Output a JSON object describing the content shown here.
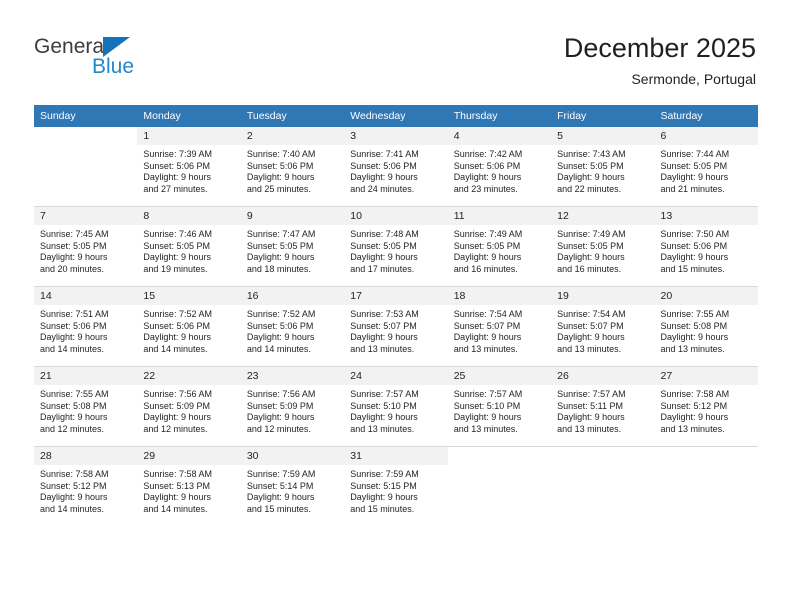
{
  "brand": {
    "name_top": "General",
    "name_bottom": "Blue",
    "triangle_color": "#1573b9",
    "blue_color": "#2288cc"
  },
  "header": {
    "title": "December 2025",
    "subtitle": "Sermonde, Portugal"
  },
  "theme": {
    "header_bar": "#2f77b5",
    "daynum_band": "#f2f2f2",
    "grid_line": "#d9d9d9",
    "text": "#231f20"
  },
  "weekday_headers": [
    "Sunday",
    "Monday",
    "Tuesday",
    "Wednesday",
    "Thursday",
    "Friday",
    "Saturday"
  ],
  "weeks": [
    [
      {
        "day": "",
        "blank": true,
        "sunrise": "",
        "sunset": "",
        "daylight1": "",
        "daylight2": ""
      },
      {
        "day": "1",
        "sunrise": "Sunrise: 7:39 AM",
        "sunset": "Sunset: 5:06 PM",
        "daylight1": "Daylight: 9 hours",
        "daylight2": "and 27 minutes."
      },
      {
        "day": "2",
        "sunrise": "Sunrise: 7:40 AM",
        "sunset": "Sunset: 5:06 PM",
        "daylight1": "Daylight: 9 hours",
        "daylight2": "and 25 minutes."
      },
      {
        "day": "3",
        "sunrise": "Sunrise: 7:41 AM",
        "sunset": "Sunset: 5:06 PM",
        "daylight1": "Daylight: 9 hours",
        "daylight2": "and 24 minutes."
      },
      {
        "day": "4",
        "sunrise": "Sunrise: 7:42 AM",
        "sunset": "Sunset: 5:06 PM",
        "daylight1": "Daylight: 9 hours",
        "daylight2": "and 23 minutes."
      },
      {
        "day": "5",
        "sunrise": "Sunrise: 7:43 AM",
        "sunset": "Sunset: 5:05 PM",
        "daylight1": "Daylight: 9 hours",
        "daylight2": "and 22 minutes."
      },
      {
        "day": "6",
        "sunrise": "Sunrise: 7:44 AM",
        "sunset": "Sunset: 5:05 PM",
        "daylight1": "Daylight: 9 hours",
        "daylight2": "and 21 minutes."
      }
    ],
    [
      {
        "day": "7",
        "sunrise": "Sunrise: 7:45 AM",
        "sunset": "Sunset: 5:05 PM",
        "daylight1": "Daylight: 9 hours",
        "daylight2": "and 20 minutes."
      },
      {
        "day": "8",
        "sunrise": "Sunrise: 7:46 AM",
        "sunset": "Sunset: 5:05 PM",
        "daylight1": "Daylight: 9 hours",
        "daylight2": "and 19 minutes."
      },
      {
        "day": "9",
        "sunrise": "Sunrise: 7:47 AM",
        "sunset": "Sunset: 5:05 PM",
        "daylight1": "Daylight: 9 hours",
        "daylight2": "and 18 minutes."
      },
      {
        "day": "10",
        "sunrise": "Sunrise: 7:48 AM",
        "sunset": "Sunset: 5:05 PM",
        "daylight1": "Daylight: 9 hours",
        "daylight2": "and 17 minutes."
      },
      {
        "day": "11",
        "sunrise": "Sunrise: 7:49 AM",
        "sunset": "Sunset: 5:05 PM",
        "daylight1": "Daylight: 9 hours",
        "daylight2": "and 16 minutes."
      },
      {
        "day": "12",
        "sunrise": "Sunrise: 7:49 AM",
        "sunset": "Sunset: 5:05 PM",
        "daylight1": "Daylight: 9 hours",
        "daylight2": "and 16 minutes."
      },
      {
        "day": "13",
        "sunrise": "Sunrise: 7:50 AM",
        "sunset": "Sunset: 5:06 PM",
        "daylight1": "Daylight: 9 hours",
        "daylight2": "and 15 minutes."
      }
    ],
    [
      {
        "day": "14",
        "sunrise": "Sunrise: 7:51 AM",
        "sunset": "Sunset: 5:06 PM",
        "daylight1": "Daylight: 9 hours",
        "daylight2": "and 14 minutes."
      },
      {
        "day": "15",
        "sunrise": "Sunrise: 7:52 AM",
        "sunset": "Sunset: 5:06 PM",
        "daylight1": "Daylight: 9 hours",
        "daylight2": "and 14 minutes."
      },
      {
        "day": "16",
        "sunrise": "Sunrise: 7:52 AM",
        "sunset": "Sunset: 5:06 PM",
        "daylight1": "Daylight: 9 hours",
        "daylight2": "and 14 minutes."
      },
      {
        "day": "17",
        "sunrise": "Sunrise: 7:53 AM",
        "sunset": "Sunset: 5:07 PM",
        "daylight1": "Daylight: 9 hours",
        "daylight2": "and 13 minutes."
      },
      {
        "day": "18",
        "sunrise": "Sunrise: 7:54 AM",
        "sunset": "Sunset: 5:07 PM",
        "daylight1": "Daylight: 9 hours",
        "daylight2": "and 13 minutes."
      },
      {
        "day": "19",
        "sunrise": "Sunrise: 7:54 AM",
        "sunset": "Sunset: 5:07 PM",
        "daylight1": "Daylight: 9 hours",
        "daylight2": "and 13 minutes."
      },
      {
        "day": "20",
        "sunrise": "Sunrise: 7:55 AM",
        "sunset": "Sunset: 5:08 PM",
        "daylight1": "Daylight: 9 hours",
        "daylight2": "and 13 minutes."
      }
    ],
    [
      {
        "day": "21",
        "sunrise": "Sunrise: 7:55 AM",
        "sunset": "Sunset: 5:08 PM",
        "daylight1": "Daylight: 9 hours",
        "daylight2": "and 12 minutes."
      },
      {
        "day": "22",
        "sunrise": "Sunrise: 7:56 AM",
        "sunset": "Sunset: 5:09 PM",
        "daylight1": "Daylight: 9 hours",
        "daylight2": "and 12 minutes."
      },
      {
        "day": "23",
        "sunrise": "Sunrise: 7:56 AM",
        "sunset": "Sunset: 5:09 PM",
        "daylight1": "Daylight: 9 hours",
        "daylight2": "and 12 minutes."
      },
      {
        "day": "24",
        "sunrise": "Sunrise: 7:57 AM",
        "sunset": "Sunset: 5:10 PM",
        "daylight1": "Daylight: 9 hours",
        "daylight2": "and 13 minutes."
      },
      {
        "day": "25",
        "sunrise": "Sunrise: 7:57 AM",
        "sunset": "Sunset: 5:10 PM",
        "daylight1": "Daylight: 9 hours",
        "daylight2": "and 13 minutes."
      },
      {
        "day": "26",
        "sunrise": "Sunrise: 7:57 AM",
        "sunset": "Sunset: 5:11 PM",
        "daylight1": "Daylight: 9 hours",
        "daylight2": "and 13 minutes."
      },
      {
        "day": "27",
        "sunrise": "Sunrise: 7:58 AM",
        "sunset": "Sunset: 5:12 PM",
        "daylight1": "Daylight: 9 hours",
        "daylight2": "and 13 minutes."
      }
    ],
    [
      {
        "day": "28",
        "sunrise": "Sunrise: 7:58 AM",
        "sunset": "Sunset: 5:12 PM",
        "daylight1": "Daylight: 9 hours",
        "daylight2": "and 14 minutes."
      },
      {
        "day": "29",
        "sunrise": "Sunrise: 7:58 AM",
        "sunset": "Sunset: 5:13 PM",
        "daylight1": "Daylight: 9 hours",
        "daylight2": "and 14 minutes."
      },
      {
        "day": "30",
        "sunrise": "Sunrise: 7:59 AM",
        "sunset": "Sunset: 5:14 PM",
        "daylight1": "Daylight: 9 hours",
        "daylight2": "and 15 minutes."
      },
      {
        "day": "31",
        "sunrise": "Sunrise: 7:59 AM",
        "sunset": "Sunset: 5:15 PM",
        "daylight1": "Daylight: 9 hours",
        "daylight2": "and 15 minutes."
      },
      {
        "day": "",
        "blank": true,
        "sunrise": "",
        "sunset": "",
        "daylight1": "",
        "daylight2": ""
      },
      {
        "day": "",
        "blank": true,
        "sunrise": "",
        "sunset": "",
        "daylight1": "",
        "daylight2": ""
      },
      {
        "day": "",
        "blank": true,
        "sunrise": "",
        "sunset": "",
        "daylight1": "",
        "daylight2": ""
      }
    ]
  ]
}
